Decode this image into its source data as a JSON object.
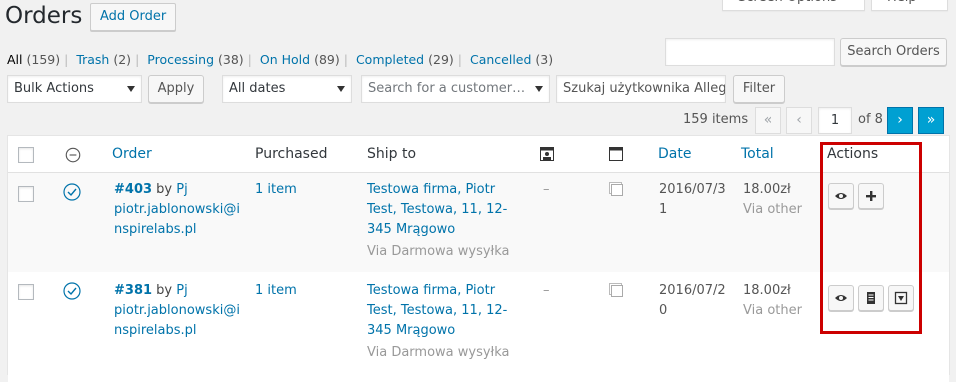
{
  "header": {
    "title": "Orders",
    "add_label": "Add Order",
    "screen_options_label": "Screen Options",
    "help_label": "Help"
  },
  "views": [
    {
      "label": "All",
      "count": "(159)",
      "current": true
    },
    {
      "label": "Trash",
      "count": "(2)"
    },
    {
      "label": "Processing",
      "count": "(38)"
    },
    {
      "label": "On Hold",
      "count": "(89)"
    },
    {
      "label": "Completed",
      "count": "(29)"
    },
    {
      "label": "Cancelled",
      "count": "(3)"
    }
  ],
  "search": {
    "input_value": "",
    "button_label": "Search Orders"
  },
  "filters": {
    "bulk_actions": "Bulk Actions",
    "apply_label": "Apply",
    "dates": "All dates",
    "customer_placeholder": "Search for a customer…",
    "allegro_placeholder": "Szukaj użytkownika Alleg",
    "filter_label": "Filter"
  },
  "pagination": {
    "items": "159 items",
    "first": "«",
    "prev": "‹",
    "current_page": "1",
    "of_label": "of 8",
    "next": "›",
    "last": "»"
  },
  "table": {
    "columns": {
      "order": "Order",
      "purchased": "Purchased",
      "ship_to": "Ship to",
      "date": "Date",
      "total": "Total",
      "actions": "Actions"
    },
    "rows": [
      {
        "order_no": "#403",
        "by": "by",
        "customer": "Pj",
        "email_1": "piotr.jablonowski@i",
        "email_2": "nspirelabs.pl",
        "purchased": "1 item",
        "ship_1": "Testowa firma, Piotr",
        "ship_2": "Test, Testowa, 11, 12-",
        "ship_3": "345 Mrągowo",
        "ship_via": "Via Darmowa wysyłka",
        "dash": "–",
        "date_1": "2016/07/3",
        "date_2": "1",
        "total": "18.00zł",
        "total_via": "Via other"
      },
      {
        "order_no": "#381",
        "by": "by",
        "customer": "Pj",
        "email_1": "piotr.jablonowski@i",
        "email_2": "nspirelabs.pl",
        "purchased": "1 item",
        "ship_1": "Testowa firma, Piotr",
        "ship_2": "Test, Testowa, 11, 12-",
        "ship_3": "345 Mrągowo",
        "ship_via": "Via Darmowa wysyłka",
        "dash": "–",
        "date_1": "2016/07/2",
        "date_2": "0",
        "total": "18.00zł",
        "total_via": "Via other"
      }
    ]
  },
  "colors": {
    "link": "#0073aa",
    "highlight": "#cc0000",
    "status_icon": "#0073aa"
  }
}
